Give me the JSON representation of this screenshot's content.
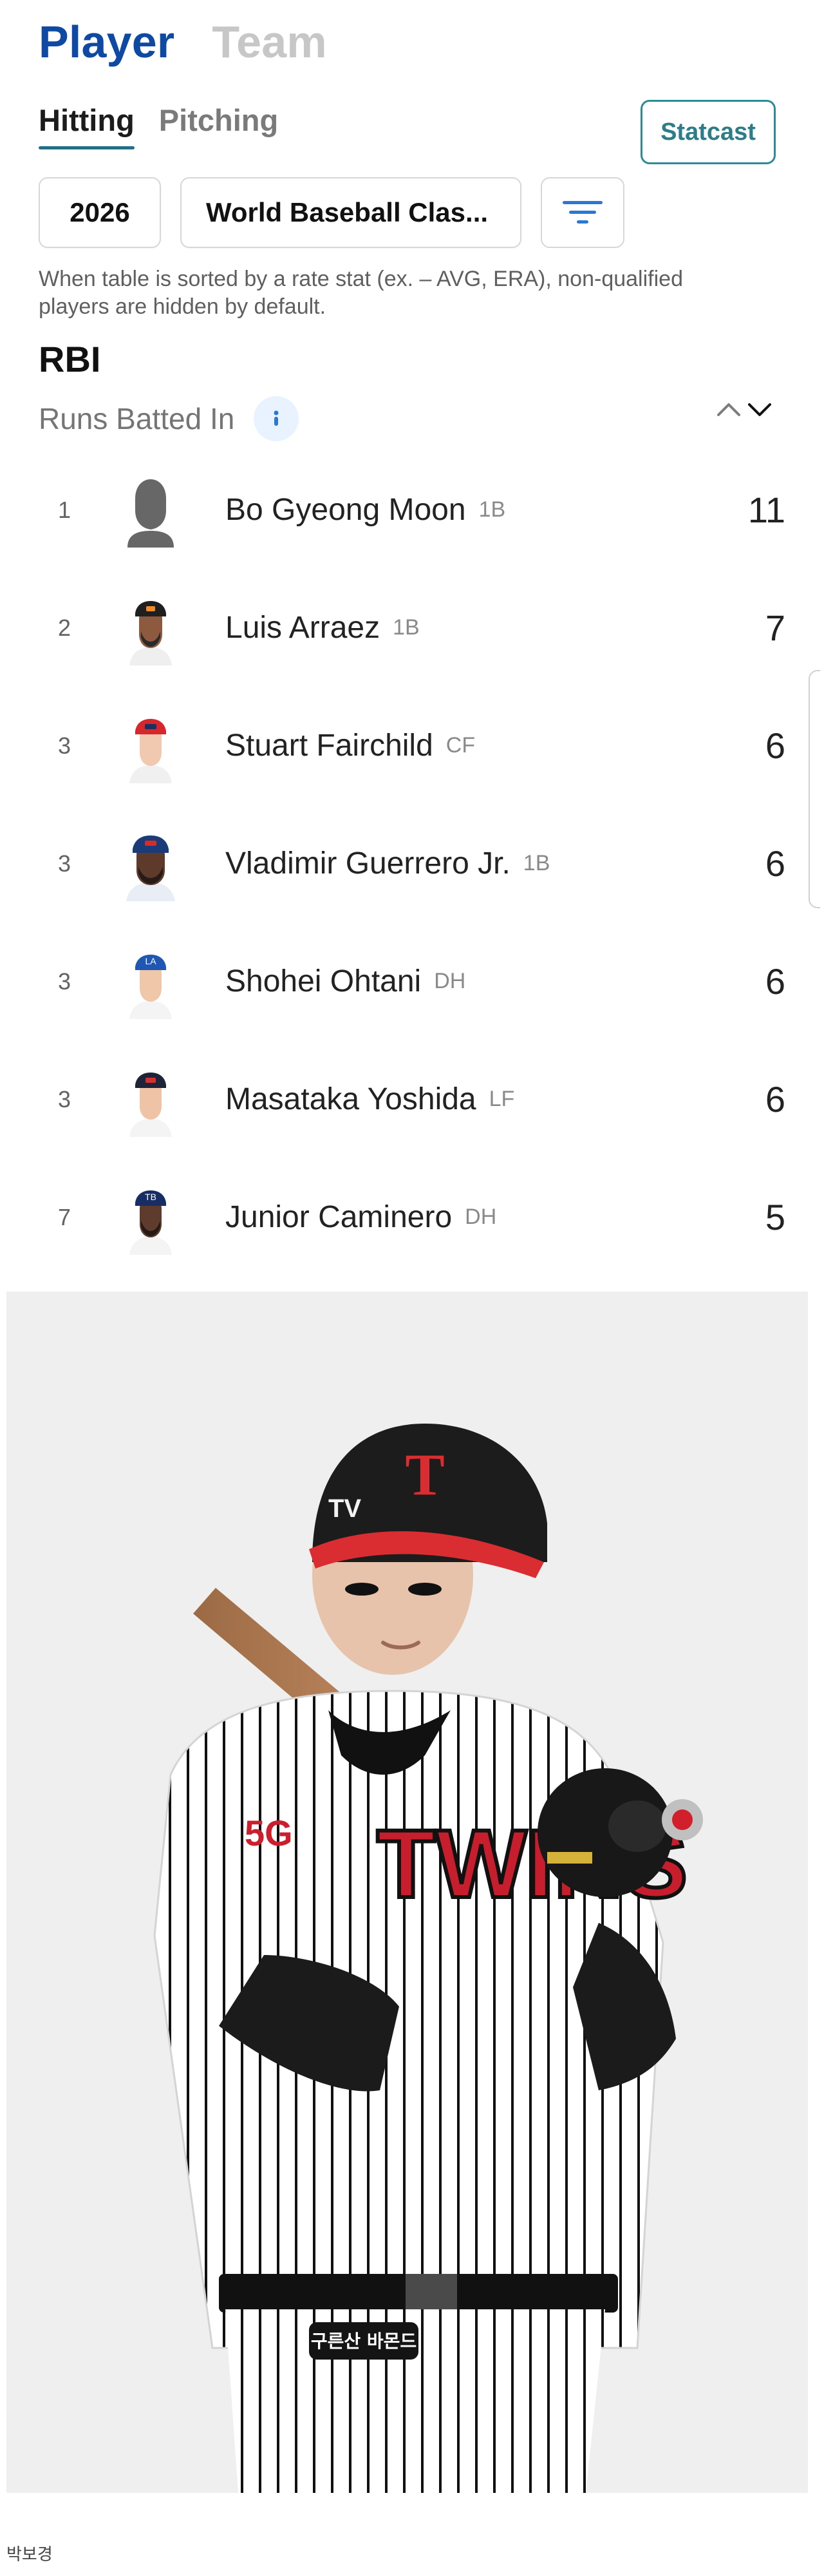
{
  "header": {
    "tabs": [
      {
        "label": "Player",
        "active": true
      },
      {
        "label": "Team",
        "active": false
      }
    ],
    "subtabs": [
      {
        "label": "Hitting",
        "active": true
      },
      {
        "label": "Pitching",
        "active": false
      }
    ],
    "statcast_label": "Statcast"
  },
  "filters": {
    "year": "2026",
    "season": "World Baseball Clas...",
    "filter_icon": "filter-icon"
  },
  "notice": {
    "text": "When table is sorted by a rate stat (ex. – AVG, ERA), non-qualified players are hidden by default."
  },
  "stat": {
    "abbr": "RBI",
    "full": "Runs Batted In",
    "info_icon": "info-icon",
    "sort_icons": [
      "sort-ascending-icon",
      "sort-descending-icon"
    ]
  },
  "leaderboard": {
    "rows": [
      {
        "rank": "1",
        "name": "Bo Gyeong Moon",
        "position": "1B",
        "value": "11"
      },
      {
        "rank": "2",
        "name": "Luis Arraez",
        "position": "1B",
        "value": "7"
      },
      {
        "rank": "3",
        "name": "Stuart Fairchild",
        "position": "CF",
        "value": "6"
      },
      {
        "rank": "3",
        "name": "Vladimir Guerrero Jr.",
        "position": "1B",
        "value": "6"
      },
      {
        "rank": "3",
        "name": "Shohei Ohtani",
        "position": "DH",
        "value": "6"
      },
      {
        "rank": "3",
        "name": "Masataka Yoshida",
        "position": "LF",
        "value": "6"
      },
      {
        "rank": "7",
        "name": "Junior Caminero",
        "position": "DH",
        "value": "5"
      }
    ]
  },
  "photo": {
    "helmet_letter": "T",
    "helmet_side": "TV",
    "jersey_text": "TWINS",
    "sleeve_text": "5G",
    "belt_text": "구른산 바몬드",
    "caption": "박보경"
  },
  "colors": {
    "accent_blue": "#0e4aa3",
    "teal": "#2c8b95",
    "muted_text": "#7a7a7a"
  }
}
